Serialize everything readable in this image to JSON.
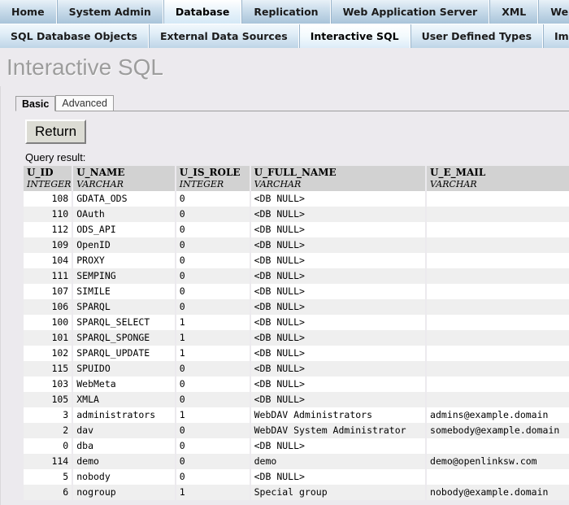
{
  "nav": {
    "primary": [
      {
        "label": "Home",
        "active": false
      },
      {
        "label": "System Admin",
        "active": false
      },
      {
        "label": "Database",
        "active": true
      },
      {
        "label": "Replication",
        "active": false
      },
      {
        "label": "Web Application Server",
        "active": false
      },
      {
        "label": "XML",
        "active": false
      },
      {
        "label": "Web Services",
        "active": false
      }
    ],
    "secondary": [
      {
        "label": "SQL Database Objects",
        "active": false
      },
      {
        "label": "External Data Sources",
        "active": false
      },
      {
        "label": "Interactive SQL",
        "active": true
      },
      {
        "label": "User Defined Types",
        "active": false
      },
      {
        "label": "Import",
        "active": false
      }
    ]
  },
  "page": {
    "title": "Interactive SQL"
  },
  "subtabs": [
    {
      "label": "Basic",
      "active": true
    },
    {
      "label": "Advanced",
      "active": false
    }
  ],
  "actions": {
    "return_label": "Return"
  },
  "result": {
    "caption": "Query result:",
    "columns": [
      {
        "name": "U_ID",
        "type": "INTEGER",
        "align": "right"
      },
      {
        "name": "U_NAME",
        "type": "VARCHAR",
        "align": "left"
      },
      {
        "name": "U_IS_ROLE",
        "type": "INTEGER",
        "align": "left"
      },
      {
        "name": "U_FULL_NAME",
        "type": "VARCHAR",
        "align": "left"
      },
      {
        "name": "U_E_MAIL",
        "type": "VARCHAR",
        "align": "left"
      }
    ],
    "rows": [
      [
        "108",
        "GDATA_ODS",
        "0",
        "<DB NULL>",
        ""
      ],
      [
        "110",
        "OAuth",
        "0",
        "<DB NULL>",
        ""
      ],
      [
        "112",
        "ODS_API",
        "0",
        "<DB NULL>",
        ""
      ],
      [
        "109",
        "OpenID",
        "0",
        "<DB NULL>",
        ""
      ],
      [
        "104",
        "PROXY",
        "0",
        "<DB NULL>",
        ""
      ],
      [
        "111",
        "SEMPING",
        "0",
        "<DB NULL>",
        ""
      ],
      [
        "107",
        "SIMILE",
        "0",
        "<DB NULL>",
        ""
      ],
      [
        "106",
        "SPARQL",
        "0",
        "<DB NULL>",
        ""
      ],
      [
        "100",
        "SPARQL_SELECT",
        "1",
        "<DB NULL>",
        ""
      ],
      [
        "101",
        "SPARQL_SPONGE",
        "1",
        "<DB NULL>",
        ""
      ],
      [
        "102",
        "SPARQL_UPDATE",
        "1",
        "<DB NULL>",
        ""
      ],
      [
        "115",
        "SPUIDO",
        "0",
        "<DB NULL>",
        ""
      ],
      [
        "103",
        "WebMeta",
        "0",
        "<DB NULL>",
        ""
      ],
      [
        "105",
        "XMLA",
        "0",
        "<DB NULL>",
        ""
      ],
      [
        "3",
        "administrators",
        "1",
        "WebDAV Administrators",
        "admins@example.domain"
      ],
      [
        "2",
        "dav",
        "0",
        "WebDAV System Administrator",
        "somebody@example.domain"
      ],
      [
        "0",
        "dba",
        "0",
        "<DB NULL>",
        ""
      ],
      [
        "114",
        "demo",
        "0",
        "demo",
        "demo@openlinksw.com"
      ],
      [
        "5",
        "nobody",
        "0",
        "<DB NULL>",
        ""
      ],
      [
        "6",
        "nogroup",
        "1",
        "Special group",
        "nobody@example.domain"
      ]
    ]
  },
  "colors": {
    "nav_bg": "#c2d4e4",
    "page_bg": "#eceaee",
    "title_text": "#9d9d9d",
    "header_cell": "#d2d2d2",
    "row_alt": "#efefef"
  }
}
